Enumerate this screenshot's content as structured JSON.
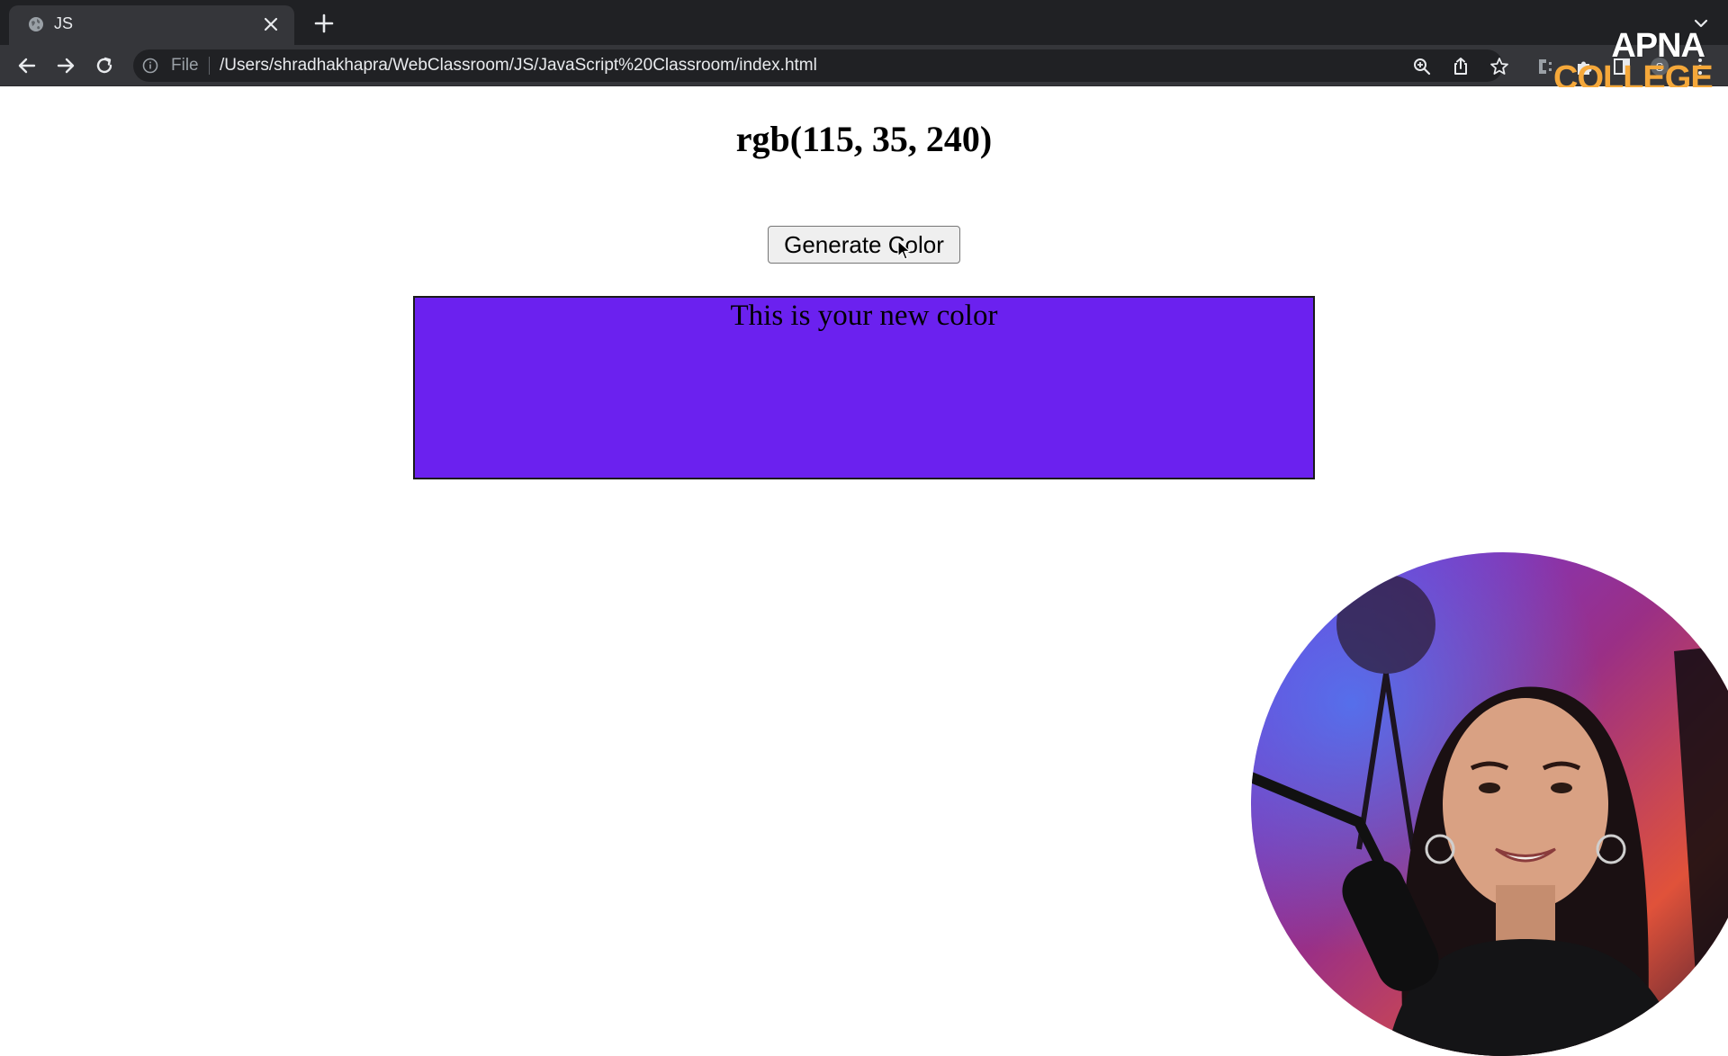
{
  "browser": {
    "tab": {
      "title": "JS"
    },
    "omnibox": {
      "scheme_label": "File",
      "url": "/Users/shradhakhapra/WebClassroom/JS/JavaScript%20Classroom/index.html"
    }
  },
  "watermark": {
    "line1": "APNA",
    "line2": "COLLEGE"
  },
  "page": {
    "heading": "rgb(115, 35, 240)",
    "button_label": "Generate Color",
    "box_text": "This is your new color",
    "box_color": "#6b21ef"
  },
  "icons": {
    "tab": [
      "globe-icon",
      "close-icon",
      "plus-icon",
      "chevron-down-icon"
    ],
    "toolbar": [
      "back-arrow-icon",
      "forward-arrow-icon",
      "reload-icon",
      "info-icon",
      "zoom-icon",
      "share-icon",
      "star-icon",
      "extension-icon",
      "puzzle-icon",
      "sidebar-icon",
      "profile-icon",
      "kebab-menu-icon"
    ]
  },
  "colors": {
    "chrome_dark": "#202124",
    "chrome_toolbar": "#35363a",
    "accent_orange": "#f5a83a"
  }
}
